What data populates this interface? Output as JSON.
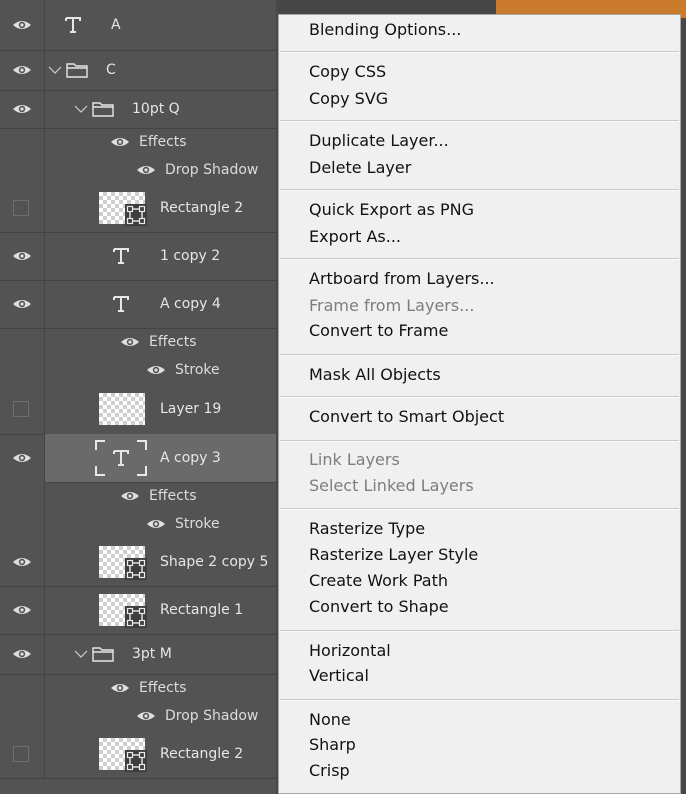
{
  "layers_panel": {
    "rows": [
      {
        "type": "text-layer",
        "label": "A",
        "visible": true
      },
      {
        "type": "group",
        "label": "C",
        "visible": true
      },
      {
        "type": "group",
        "label": "10pt Q",
        "visible": true
      },
      {
        "type": "effects",
        "label": "Effects"
      },
      {
        "type": "effect",
        "label": "Drop Shadow"
      },
      {
        "type": "shape-layer",
        "label": "Rectangle 2",
        "visible": false
      },
      {
        "type": "text-layer",
        "label": "1 copy 2",
        "visible": true
      },
      {
        "type": "text-layer",
        "label": "A copy 4",
        "visible": true
      },
      {
        "type": "effects",
        "label": "Effects"
      },
      {
        "type": "effect",
        "label": "Stroke"
      },
      {
        "type": "pixel-layer",
        "label": "Layer 19",
        "visible": false
      },
      {
        "type": "text-layer",
        "label": "A copy 3",
        "visible": true,
        "selected": true
      },
      {
        "type": "effects",
        "label": "Effects"
      },
      {
        "type": "effect",
        "label": "Stroke"
      },
      {
        "type": "shape-layer",
        "label": "Shape 2 copy 5",
        "visible": true
      },
      {
        "type": "shape-layer",
        "label": "Rectangle 1",
        "visible": true
      },
      {
        "type": "group",
        "label": "3pt M",
        "visible": true
      },
      {
        "type": "effects",
        "label": "Effects"
      },
      {
        "type": "effect",
        "label": "Drop Shadow"
      },
      {
        "type": "shape-layer",
        "label": "Rectangle 2",
        "visible": false
      }
    ]
  },
  "context_menu": {
    "items": [
      {
        "label": "Blending Options...",
        "enabled": true
      },
      {
        "label": "Copy CSS",
        "enabled": true
      },
      {
        "label": "Copy SVG",
        "enabled": true
      },
      {
        "label": "Duplicate Layer...",
        "enabled": true
      },
      {
        "label": "Delete Layer",
        "enabled": true
      },
      {
        "label": "Quick Export as PNG",
        "enabled": true
      },
      {
        "label": "Export As...",
        "enabled": true
      },
      {
        "label": "Artboard from Layers...",
        "enabled": true
      },
      {
        "label": "Frame from Layers...",
        "enabled": false
      },
      {
        "label": "Convert to Frame",
        "enabled": true
      },
      {
        "label": "Mask All Objects",
        "enabled": true
      },
      {
        "label": "Convert to Smart Object",
        "enabled": true
      },
      {
        "label": "Link Layers",
        "enabled": false
      },
      {
        "label": "Select Linked Layers",
        "enabled": false
      },
      {
        "label": "Rasterize Type",
        "enabled": true
      },
      {
        "label": "Rasterize Layer Style",
        "enabled": true
      },
      {
        "label": "Create Work Path",
        "enabled": true
      },
      {
        "label": "Convert to Shape",
        "enabled": true
      },
      {
        "label": "Horizontal",
        "enabled": true
      },
      {
        "label": "Vertical",
        "enabled": true
      },
      {
        "label": "None",
        "enabled": true
      },
      {
        "label": "Sharp",
        "enabled": true
      },
      {
        "label": "Crisp",
        "enabled": true
      }
    ]
  },
  "colors": {
    "panel_bg": "#535353",
    "selected_row": "#6a6a6a",
    "menu_bg": "#f0f0f0",
    "menu_text": "#121212",
    "menu_disabled": "#7d7d7d",
    "canvas_accent": "#c97a2a"
  }
}
